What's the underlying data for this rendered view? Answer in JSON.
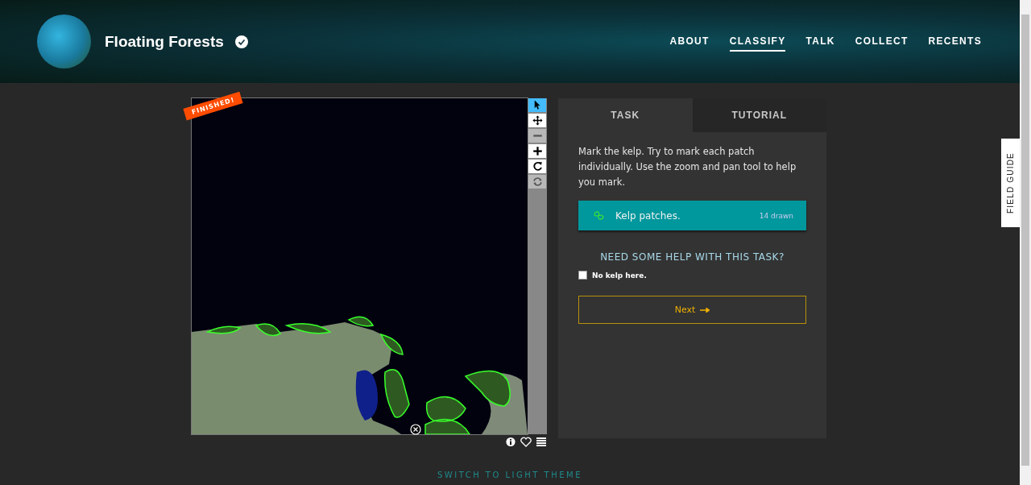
{
  "header": {
    "title": "Floating Forests",
    "verified": true,
    "nav": [
      {
        "label": "ABOUT",
        "selected": false
      },
      {
        "label": "CLASSIFY",
        "selected": true
      },
      {
        "label": "TALK",
        "selected": false
      },
      {
        "label": "COLLECT",
        "selected": false
      },
      {
        "label": "RECENTS",
        "selected": false
      }
    ]
  },
  "subject": {
    "badge": "FINISHED!",
    "tools": [
      {
        "kind": "select",
        "selected": true,
        "disabled": false
      },
      {
        "kind": "pan",
        "selected": false,
        "disabled": false
      },
      {
        "kind": "zoom-out",
        "selected": false,
        "disabled": true
      },
      {
        "kind": "zoom-in",
        "selected": false,
        "disabled": false
      },
      {
        "kind": "rotate",
        "selected": false,
        "disabled": false
      },
      {
        "kind": "reset",
        "selected": false,
        "disabled": true
      }
    ]
  },
  "task_panel": {
    "tabs": [
      {
        "label": "TASK",
        "selected": true
      },
      {
        "label": "TUTORIAL",
        "selected": false
      }
    ],
    "instruction": "Mark the kelp. Try to mark each patch individually. Use the zoom and pan tool to help you mark.",
    "tool": {
      "label": "Kelp patches.",
      "count": "14 drawn",
      "selected": true
    },
    "help": "NEED SOME HELP WITH THIS TASK?",
    "checkbox": {
      "label": "No kelp here.",
      "checked": false
    },
    "next": "Next"
  },
  "field_guide": "FIELD GUIDE",
  "footer": "SWITCH TO LIGHT THEME"
}
